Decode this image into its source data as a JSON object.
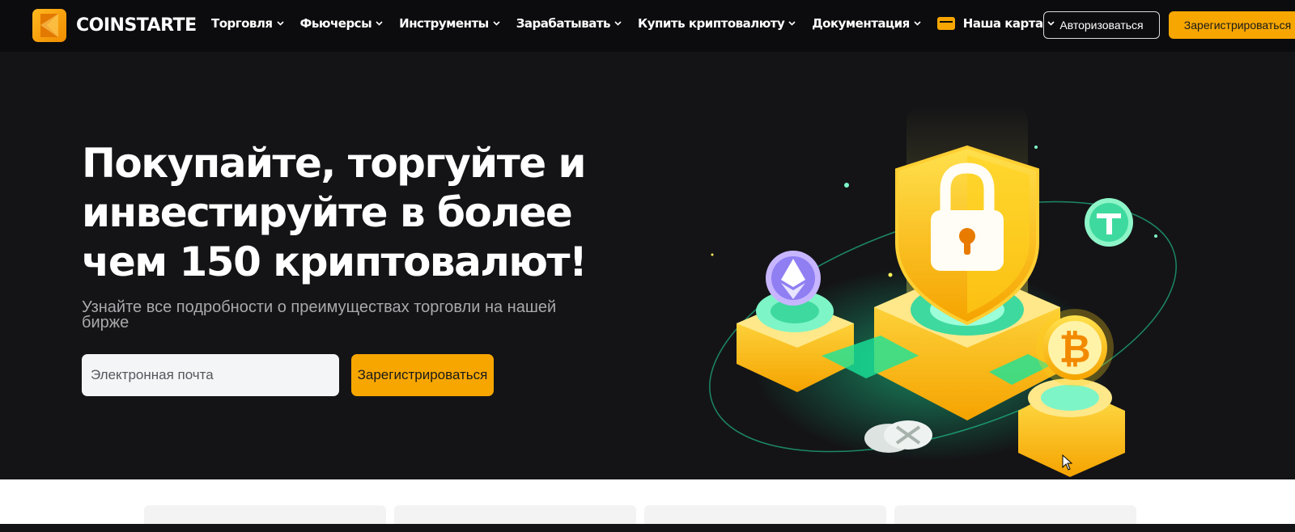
{
  "brand": {
    "name": "COINSTARTE",
    "logo_icon": "coinstarte-logo-icon",
    "accent_color": "#f7a600"
  },
  "nav": {
    "items": [
      {
        "label": "Торговля",
        "icon": "chevron-down-icon"
      },
      {
        "label": "Фьючерсы",
        "icon": "chevron-down-icon"
      },
      {
        "label": "Инструменты",
        "icon": "chevron-down-icon"
      },
      {
        "label": "Зарабатывать",
        "icon": "chevron-down-icon"
      },
      {
        "label": "Купить криптовалюту",
        "icon": "chevron-down-icon"
      },
      {
        "label": "Документация",
        "icon": "chevron-down-icon"
      },
      {
        "label": "Наша карта",
        "icon": "credit-card-icon"
      }
    ],
    "login_label": "Авторизоваться",
    "signup_label": "Зарегистрироваться"
  },
  "hero": {
    "title": "Покупайте, торгуйте и инвестируйте в более чем 150 криптовалют!",
    "subtitle": "Узнайте все подробности о преимуществах торговли на нашей бирже",
    "email_placeholder": "Электронная почта",
    "email_value": "",
    "signup_label": "Зарегистрироваться",
    "illustration_icons": [
      "shield-lock-icon",
      "ethereum-coin-icon",
      "tether-coin-icon",
      "bitcoin-coin-icon",
      "xrp-coin-icon"
    ]
  },
  "colors": {
    "background": "#141417",
    "navbar": "#0c0c0e",
    "input_bg": "#f4f5f7",
    "crypto_green": "#19e39a"
  }
}
